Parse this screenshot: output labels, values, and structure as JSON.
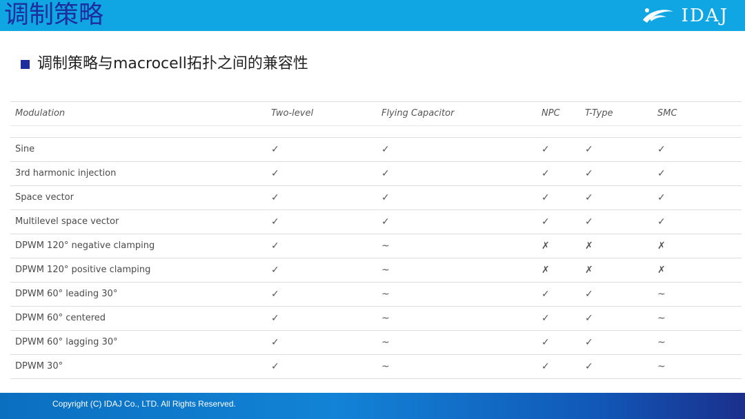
{
  "header": {
    "title": "调制策略",
    "logo_text": "IDAJ"
  },
  "subheading": "调制策略与macrocell拓扑之间的兼容性",
  "table": {
    "columns": [
      "Modulation",
      "Two-level",
      "Flying Capacitor",
      "NPC",
      "T-Type",
      "SMC"
    ],
    "rows": [
      [
        "Sine",
        "✓",
        "✓",
        "✓",
        "✓",
        "✓"
      ],
      [
        "3rd harmonic injection",
        "✓",
        "✓",
        "✓",
        "✓",
        "✓"
      ],
      [
        "Space vector",
        "✓",
        "✓",
        "✓",
        "✓",
        "✓"
      ],
      [
        "Multilevel space vector",
        "✓",
        "✓",
        "✓",
        "✓",
        "✓"
      ],
      [
        "DPWM 120° negative clamping",
        "✓",
        "~",
        "✗",
        "✗",
        "✗"
      ],
      [
        "DPWM 120° positive clamping",
        "✓",
        "~",
        "✗",
        "✗",
        "✗"
      ],
      [
        "DPWM 60° leading 30°",
        "✓",
        "~",
        "✓",
        "✓",
        "~"
      ],
      [
        "DPWM 60° centered",
        "✓",
        "~",
        "✓",
        "✓",
        "~"
      ],
      [
        "DPWM 60° lagging 30°",
        "✓",
        "~",
        "✓",
        "✓",
        "~"
      ],
      [
        "DPWM 30°",
        "✓",
        "~",
        "✓",
        "✓",
        "~"
      ]
    ]
  },
  "footer": {
    "copyright": "Copyright (C)  IDAJ Co., LTD. All Rights Reserved."
  },
  "colors": {
    "header_band": "#10a6e3",
    "title_text": "#1d2d9d",
    "bullet": "#1d2d9d",
    "footer_start": "#0b6fc0",
    "footer_end": "#1b2f8c"
  },
  "icons": {
    "logo": "idaj-swoosh-logo-icon",
    "bullet": "square-bullet-icon"
  }
}
